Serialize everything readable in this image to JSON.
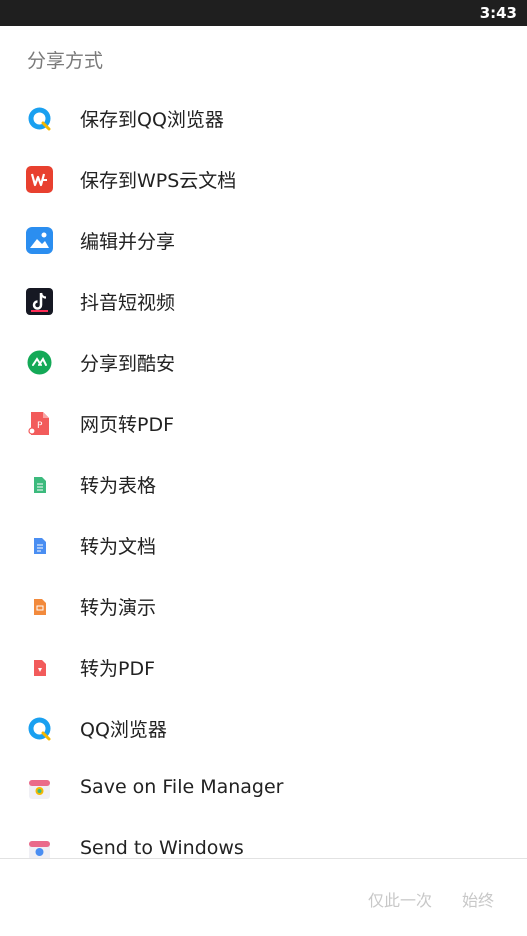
{
  "status_bar": {
    "time": "3:43"
  },
  "sheet": {
    "title": "分享方式"
  },
  "items": [
    {
      "label": "保存到QQ浏览器",
      "icon": "qq-browser-icon"
    },
    {
      "label": "保存到WPS云文档",
      "icon": "wps-icon"
    },
    {
      "label": "编辑并分享",
      "icon": "gallery-edit-icon"
    },
    {
      "label": "抖音短视频",
      "icon": "douyin-icon"
    },
    {
      "label": "分享到酷安",
      "icon": "coolapk-icon"
    },
    {
      "label": "网页转PDF",
      "icon": "pdf-convert-icon"
    },
    {
      "label": "转为表格",
      "icon": "spreadsheet-icon"
    },
    {
      "label": "转为文档",
      "icon": "document-icon"
    },
    {
      "label": "转为演示",
      "icon": "presentation-icon"
    },
    {
      "label": "转为PDF",
      "icon": "pdf-icon"
    },
    {
      "label": "QQ浏览器",
      "icon": "qq-browser-icon"
    },
    {
      "label": "Save on File Manager",
      "icon": "file-manager-icon"
    },
    {
      "label": "Send to Windows",
      "icon": "send-to-windows-icon"
    }
  ],
  "actions": {
    "once": "仅此一次",
    "always": "始终"
  },
  "colors": {
    "status_bar": "#1f1f1f",
    "wps_red": "#e8402f",
    "coolapk_green": "#14a957",
    "disabled_text": "#c8c8c8"
  }
}
